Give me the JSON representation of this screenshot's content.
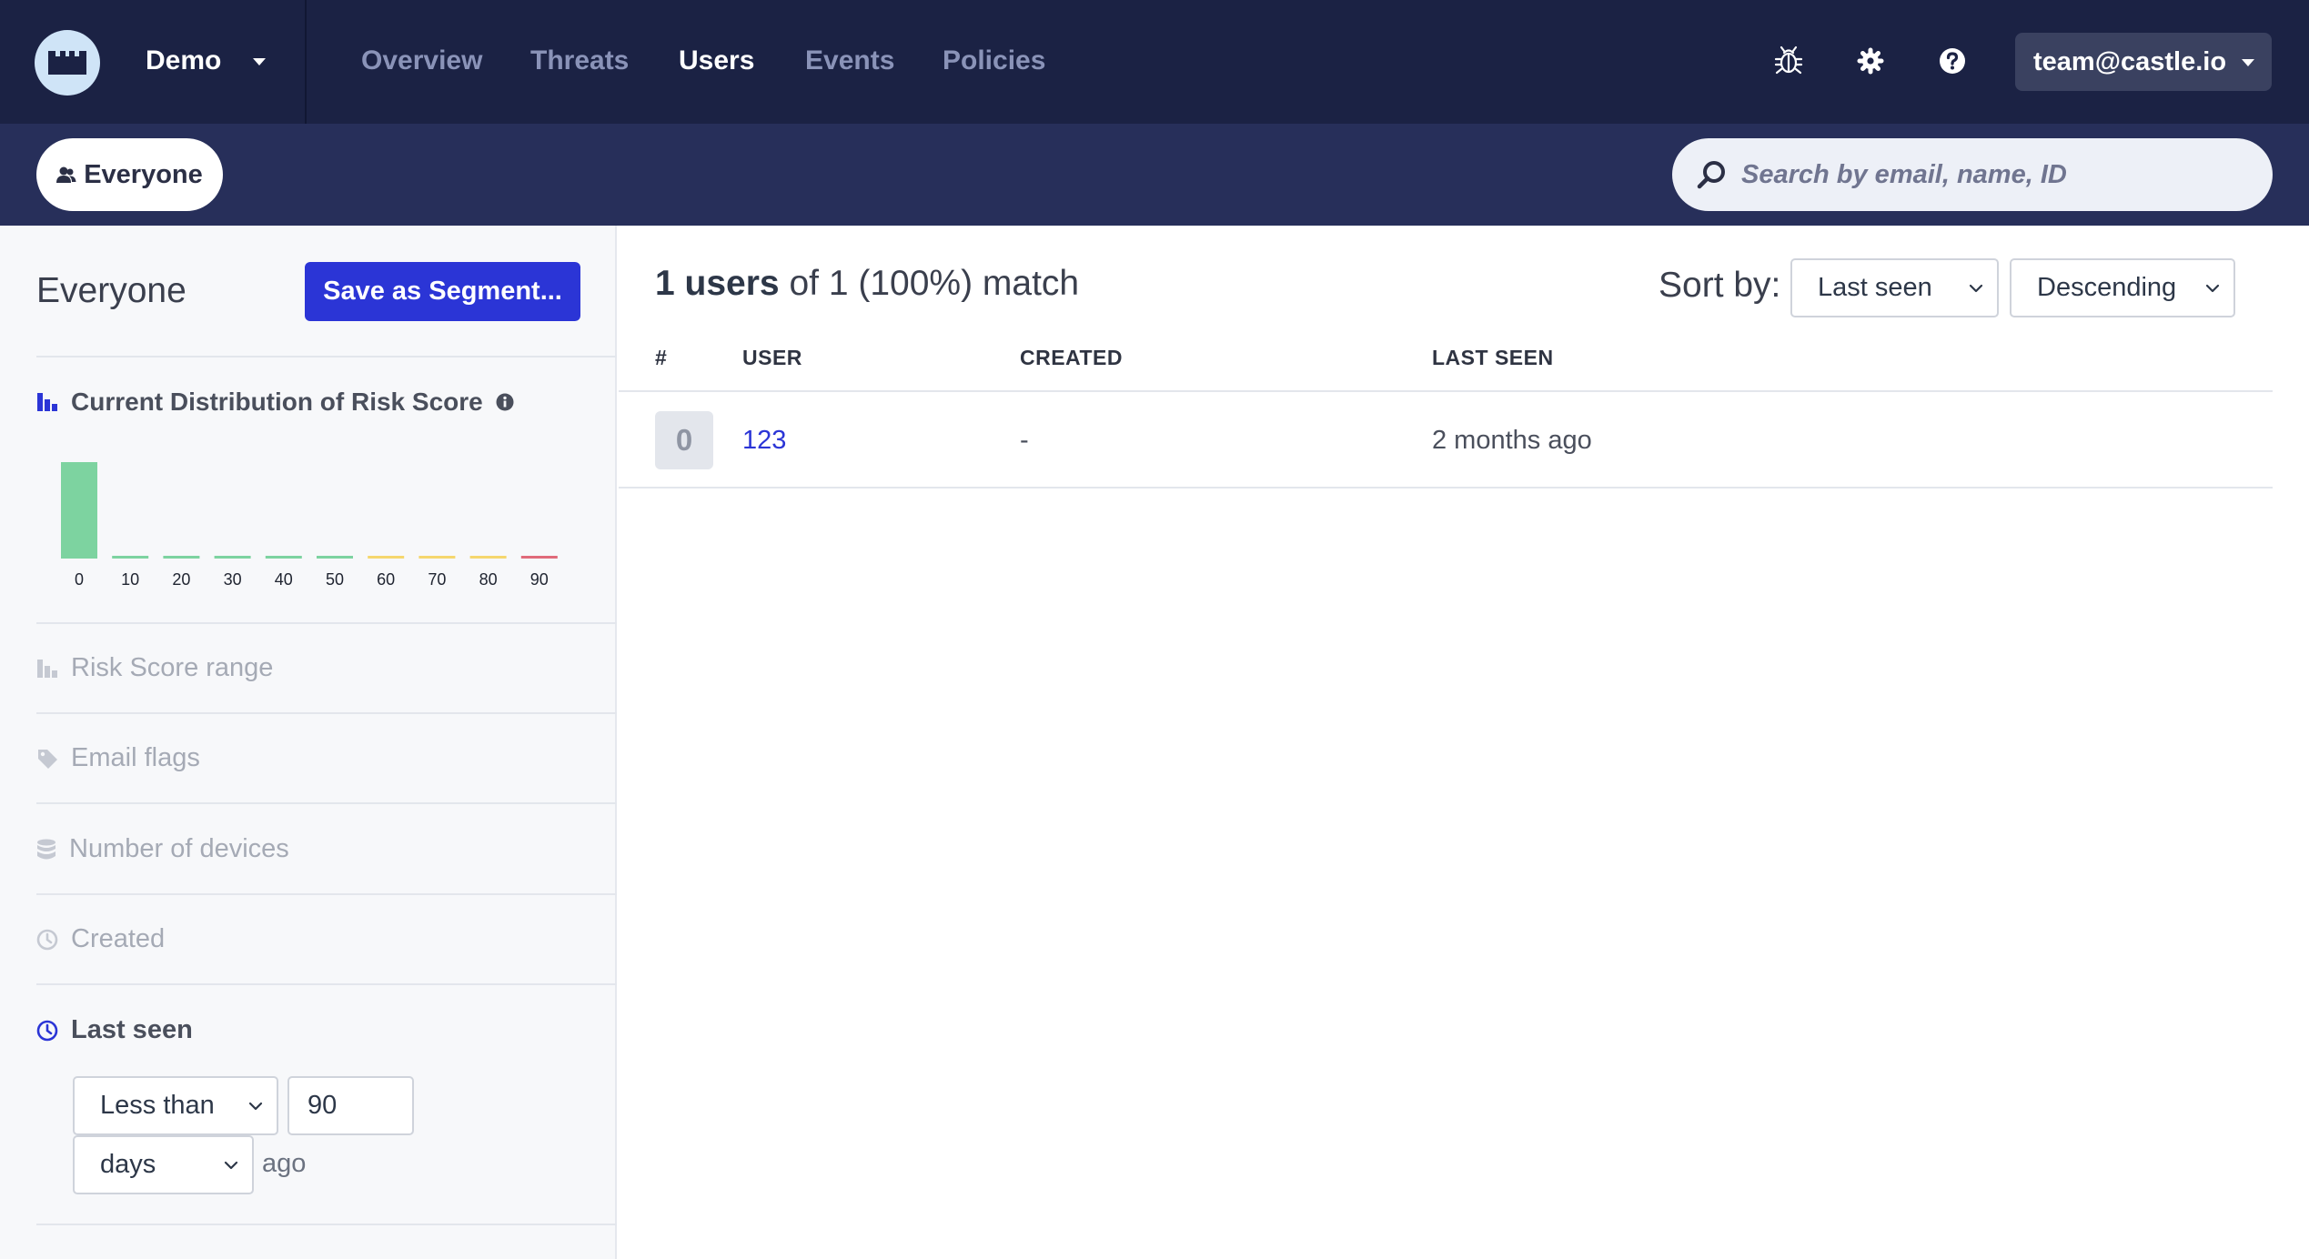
{
  "topnav": {
    "org_name": "Demo",
    "links": [
      {
        "label": "Overview"
      },
      {
        "label": "Threats"
      },
      {
        "label": "Users"
      },
      {
        "label": "Events"
      },
      {
        "label": "Policies"
      }
    ],
    "active_link": "Users",
    "icons": [
      "bug-icon",
      "gear-icon",
      "help-icon"
    ],
    "account_email": "team@castle.io"
  },
  "subbar": {
    "segment_label": "Everyone",
    "search_placeholder": "Search by email, name, ID"
  },
  "sidebar": {
    "title": "Everyone",
    "save_button": "Save as Segment...",
    "distribution_title": "Current Distribution of Risk Score",
    "filters": [
      {
        "label": "Risk Score range",
        "icon": "bar-chart-icon",
        "active": false
      },
      {
        "label": "Email flags",
        "icon": "tag-icon",
        "active": false
      },
      {
        "label": "Number of devices",
        "icon": "database-icon",
        "active": false
      },
      {
        "label": "Created",
        "icon": "clock-icon",
        "active": false
      },
      {
        "label": "Last seen",
        "icon": "clock-icon",
        "active": true
      }
    ],
    "last_seen": {
      "operator": "Less than",
      "value": "90",
      "unit": "days",
      "suffix": "ago"
    }
  },
  "main": {
    "match_count": "1 users",
    "match_rest": "of 1 (100%) match",
    "sort_label": "Sort by:",
    "sort_field": "Last seen",
    "sort_order": "Descending",
    "columns": [
      "#",
      "USER",
      "CREATED",
      "LAST SEEN"
    ],
    "rows": [
      {
        "score": "0",
        "user": "123",
        "created": "-",
        "last_seen": "2 months ago"
      }
    ]
  },
  "colors": {
    "nav_bg": "#1b2244",
    "subbar_bg": "#272f5a",
    "primary": "#2b35d6",
    "bar_low": "#7dd3a0",
    "bar_mid": "#f5d76e",
    "bar_high": "#e06b7a"
  },
  "chart_data": {
    "type": "bar",
    "categories": [
      "0",
      "10",
      "20",
      "30",
      "40",
      "50",
      "60",
      "70",
      "80",
      "90"
    ],
    "values": [
      1,
      0,
      0,
      0,
      0,
      0,
      0,
      0,
      0,
      0
    ],
    "bar_colors": [
      "#7dd3a0",
      "#7dd3a0",
      "#7dd3a0",
      "#7dd3a0",
      "#7dd3a0",
      "#7dd3a0",
      "#f5d76e",
      "#f5d76e",
      "#f5d76e",
      "#e06b7a"
    ],
    "ylim": [
      0,
      1
    ],
    "title": "Current Distribution of Risk Score",
    "xlabel": "",
    "ylabel": "",
    "grid": false
  }
}
